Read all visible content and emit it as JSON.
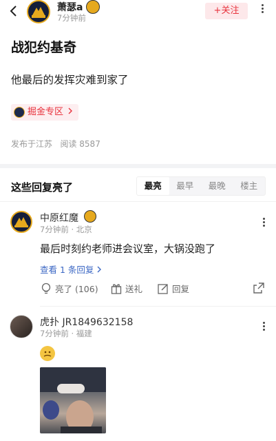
{
  "header": {
    "username": "萧瑟a",
    "time": "7分钟前",
    "follow_label": "+关注"
  },
  "post": {
    "title": "战犯约基奇",
    "body": "他最后的发挥灾难到家了",
    "zone_label": "掘金专区",
    "location": "发布于江苏",
    "reads": "阅读 8587"
  },
  "replies": {
    "section_title": "这些回复亮了",
    "sort_tabs": [
      "最亮",
      "最早",
      "最晚",
      "楼主"
    ],
    "items": [
      {
        "username": "中原红魔",
        "time": "7分钟前 · 北京",
        "text": "最后时刻约老师进会议室，大锅没跑了",
        "view_replies": "查看 1 条回复",
        "like_label": "亮了 (106)",
        "gift_label": "送礼",
        "reply_label": "回复"
      },
      {
        "username": "虎扑 JR1849632158",
        "time": "7分钟前 · 福建"
      }
    ]
  },
  "colors": {
    "accent": "#e8323c",
    "link": "#3b67c4",
    "nuggets_gold": "#e6a91e"
  }
}
